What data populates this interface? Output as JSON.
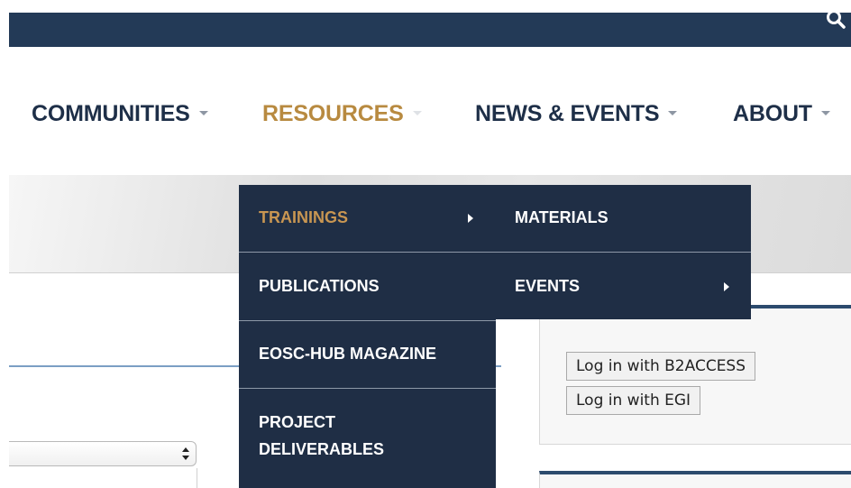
{
  "nav": {
    "items": [
      {
        "label": "COMMUNITIES",
        "active": false
      },
      {
        "label": "RESOURCES",
        "active": true
      },
      {
        "label": "NEWS & EVENTS",
        "active": false
      },
      {
        "label": "ABOUT",
        "active": false
      }
    ],
    "search_icon": "search-icon"
  },
  "dropdown": {
    "items": [
      {
        "label": "TRAININGS",
        "has_submenu": true,
        "highlighted": true
      },
      {
        "label": "PUBLICATIONS",
        "has_submenu": false
      },
      {
        "label": "EOSC-HUB MAGAZINE",
        "has_submenu": false
      },
      {
        "label_line1": "PROJECT",
        "label_line2": "DELIVERABLES",
        "has_submenu": false
      }
    ]
  },
  "submenu": {
    "items": [
      {
        "label": "MATERIALS",
        "has_submenu": false
      },
      {
        "label": "EVENTS",
        "has_submenu": true
      }
    ]
  },
  "login": {
    "b2access_label": "Log in with B2ACCESS",
    "egi_label": "Log in with EGI"
  },
  "colors": {
    "topbar": "#233a57",
    "nav_text": "#1e2f48",
    "nav_active": "#b88a40",
    "menu_bg": "#1f2e45",
    "menu_highlight": "#c89652"
  }
}
